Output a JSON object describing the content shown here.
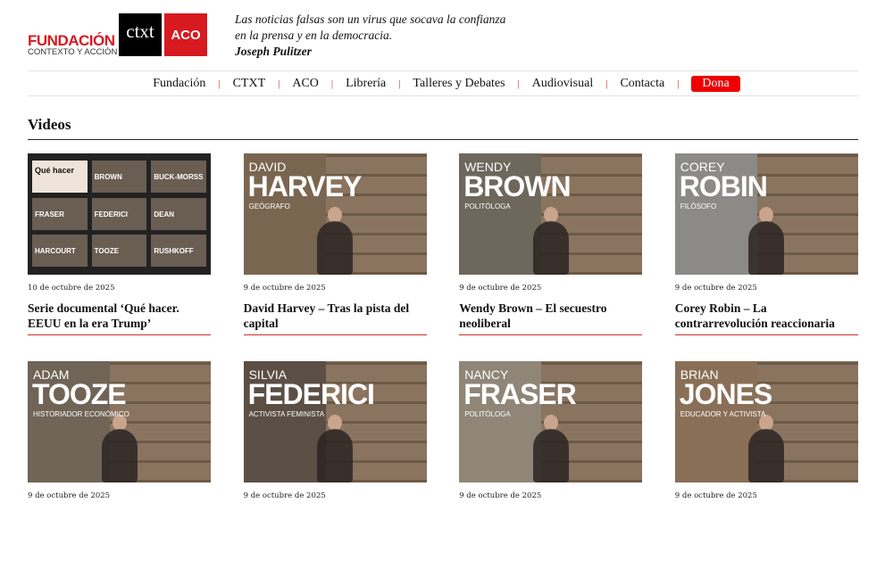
{
  "header": {
    "logo_main": "FUNDACIÓN",
    "logo_sub": "CONTEXTO Y ACCIÓN",
    "ctxt": "ctxt",
    "aco": "ACO",
    "quote": "Las noticias falsas son un virus que socava la confianza en la prensa y en la democracia.",
    "author": "Joseph Pulitzer"
  },
  "nav": [
    "Fundación",
    "CTXT",
    "ACO",
    "Librería",
    "Talleres y Debates",
    "Audiovisual",
    "Contacta"
  ],
  "nav_dona": "Dona",
  "section_title": "Videos",
  "mosaic": [
    "Qué hacer",
    "BROWN",
    "BUCK-MORSS",
    "FRASER",
    "FEDERICI",
    "DEAN",
    "HARCOURT",
    "TOOZE",
    "RUSHKOFF"
  ],
  "videos": [
    {
      "date": "10 de octubre de 2025",
      "title": "Serie documental ‘Qué hacer. EEUU en la era Trump’"
    },
    {
      "date": "9 de octubre de 2025",
      "title": "David Harvey – Tras la pista del capital",
      "first": "DAVID",
      "last": "HARVEY",
      "role": "GEÓGRAFO",
      "bg": "#7a6650"
    },
    {
      "date": "9 de octubre de 2025",
      "title": "Wendy Brown – El secuestro neoliberal",
      "first": "WENDY",
      "last": "BROWN",
      "role": "POLITÓLOGA",
      "bg": "#6d675c"
    },
    {
      "date": "9 de octubre de 2025",
      "title": "Corey Robin – La contrarrevolución reaccionaria",
      "first": "COREY",
      "last": "ROBIN",
      "role": "FILÓSOFO",
      "bg": "#8c8a86"
    },
    {
      "date": "9 de octubre de 2025",
      "first": "ADAM",
      "last": "TOOZE",
      "role": "HISTORIADOR ECONÓMICO",
      "bg": "#6f6456"
    },
    {
      "date": "9 de octubre de 2025",
      "first": "SILVIA",
      "last": "FEDERICI",
      "role": "ACTIVISTA FEMINISTA",
      "bg": "#5b4e44"
    },
    {
      "date": "9 de octubre de 2025",
      "first": "NANCY",
      "last": "FRASER",
      "role": "POLITÓLOGA",
      "bg": "#8f8678"
    },
    {
      "date": "9 de octubre de 2025",
      "first": "BRIAN",
      "last": "JONES",
      "role": "EDUCADOR Y ACTIVISTA",
      "bg": "#8a6f57"
    }
  ]
}
